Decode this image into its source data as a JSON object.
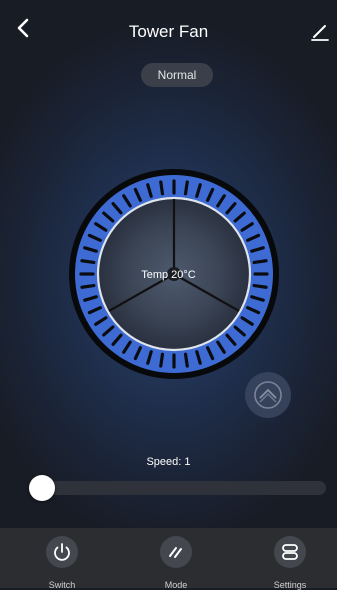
{
  "header": {
    "title": "Tower Fan"
  },
  "mode": {
    "label": "Normal"
  },
  "dial": {
    "temperature_label": "Temp 20°C"
  },
  "speed": {
    "label": "Speed: 1",
    "level": 1,
    "fraction": 0.0
  },
  "nav": [
    {
      "label": "Switch",
      "icon": "power-icon"
    },
    {
      "label": "Mode",
      "icon": "mode-slashes-icon"
    },
    {
      "label": "Settings",
      "icon": "settings-icon"
    }
  ],
  "colors": {
    "ring_blue": "#3d6bd3",
    "background": "#1c2333",
    "bottom_bar": "#2b2d31"
  }
}
